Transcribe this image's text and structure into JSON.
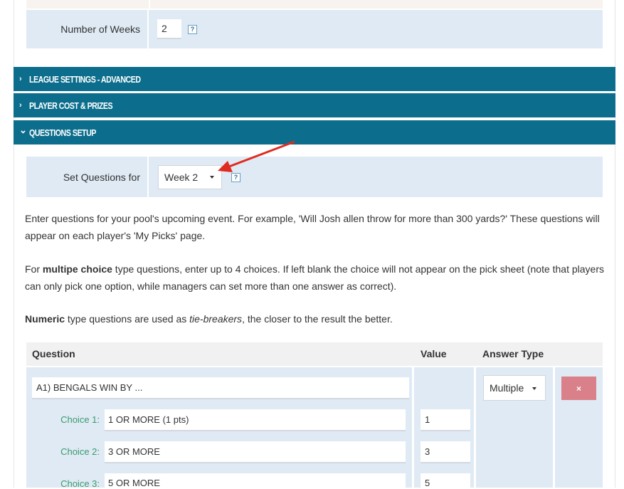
{
  "settings": {
    "weeks_label": "Number of Weeks",
    "weeks_value": "2"
  },
  "sections": [
    {
      "label": "LEAGUE SETTINGS - ADVANCED",
      "expanded": false
    },
    {
      "label": "PLAYER COST & PRIZES",
      "expanded": false
    },
    {
      "label": "QUESTIONS SETUP",
      "expanded": true
    }
  ],
  "questions_setup": {
    "set_questions_label": "Set Questions for",
    "week_selected": "Week 2",
    "intro_text": "Enter questions for your pool's upcoming event. For example, 'Will Josh allen throw for more than 300 yards?' These questions will appear on each player's 'My Picks' page.",
    "mc_prefix": "For ",
    "mc_bold": "multipe choice",
    "mc_text": " type questions, enter up to 4 choices. If left blank the choice will not appear on the pick sheet (note that players can only pick one option, while managers can set more than one answer as correct).",
    "numeric_bold": "Numeric",
    "numeric_mid": " type questions are used as ",
    "numeric_italic": "tie-breakers",
    "numeric_end": ", the closer to the result the better."
  },
  "table": {
    "headers": {
      "question": "Question",
      "value": "Value",
      "answer_type": "Answer Type"
    },
    "question": "A1) BENGALS WIN BY ...",
    "answer_type": "Multiple",
    "delete_icon": "×",
    "choices": [
      {
        "label": "Choice 1:",
        "text": "1 OR MORE (1 pts)",
        "value": "1"
      },
      {
        "label": "Choice 2:",
        "text": "3 OR MORE",
        "value": "3"
      },
      {
        "label": "Choice 3:",
        "text": "5 OR MORE",
        "value": "5"
      }
    ]
  },
  "icons": {
    "help": "help-icon",
    "chevron_right": "›",
    "chevron_down": "⌄"
  },
  "colors": {
    "section_bar": "#0c6e8c",
    "row_bg": "#dfeaf4",
    "delete_btn": "#d9808a",
    "choice_label": "#3b9a6e",
    "annotation_arrow": "#e02b20"
  }
}
